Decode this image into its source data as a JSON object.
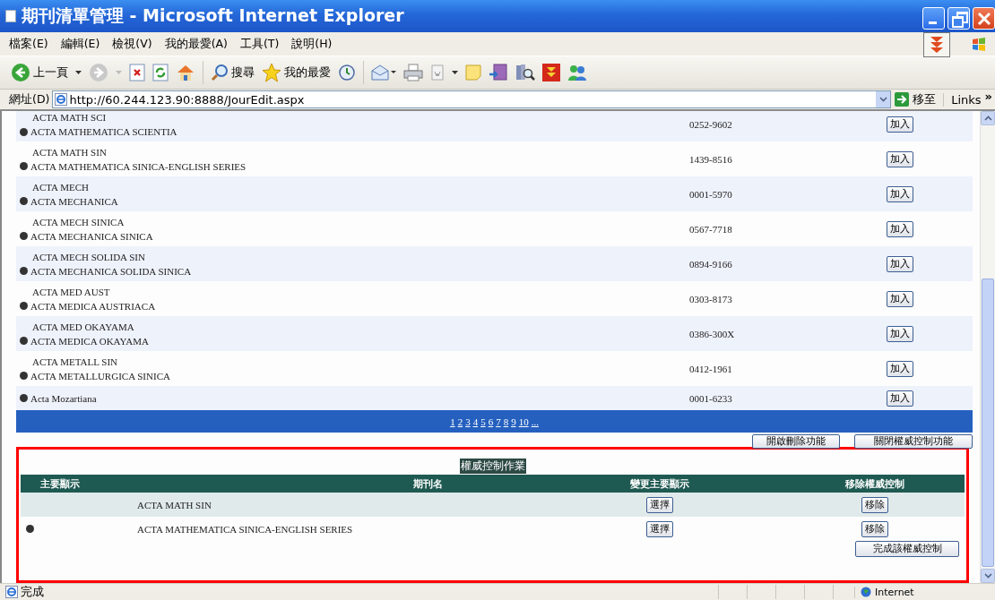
{
  "window": {
    "title": "期刊清單管理 - Microsoft Internet Explorer"
  },
  "menu": [
    "檔案(E)",
    "編輯(E)",
    "檢視(V)",
    "我的最愛(A)",
    "工具(T)",
    "說明(H)"
  ],
  "toolbar": {
    "back": "上一頁",
    "search": "搜尋",
    "favorites": "我的最愛"
  },
  "address": {
    "label": "網址(D)",
    "url": "http://60.244.123.90:8888/JourEdit.aspx",
    "go": "移至",
    "links": "Links",
    "more": "»"
  },
  "journals": [
    {
      "abbrev": "ACTA MATH SCI",
      "title": "ACTA MATHEMATICA SCIENTIA",
      "issn": "0252-9602",
      "action": "加入"
    },
    {
      "abbrev": "ACTA MATH SIN",
      "title": "ACTA MATHEMATICA SINICA-ENGLISH SERIES",
      "issn": "1439-8516",
      "action": "加入"
    },
    {
      "abbrev": "ACTA MECH",
      "title": "ACTA MECHANICA",
      "issn": "0001-5970",
      "action": "加入"
    },
    {
      "abbrev": "ACTA MECH SINICA",
      "title": "ACTA MECHANICA SINICA",
      "issn": "0567-7718",
      "action": "加入"
    },
    {
      "abbrev": "ACTA MECH SOLIDA SIN",
      "title": "ACTA MECHANICA SOLIDA SINICA",
      "issn": "0894-9166",
      "action": "加入"
    },
    {
      "abbrev": "ACTA MED AUST",
      "title": "ACTA MEDICA AUSTRIACA",
      "issn": "0303-8173",
      "action": "加入"
    },
    {
      "abbrev": "ACTA MED OKAYAMA",
      "title": "ACTA MEDICA OKAYAMA",
      "issn": "0386-300X",
      "action": "加入"
    },
    {
      "abbrev": "ACTA METALL SIN",
      "title": "ACTA METALLURGICA SINICA",
      "issn": "0412-1961",
      "action": "加入"
    },
    {
      "title": "Acta Mozartiana",
      "issn": "0001-6233",
      "action": "加入"
    }
  ],
  "pagination": [
    "1",
    "2",
    "3",
    "4",
    "5",
    "6",
    "7",
    "8",
    "9",
    "10",
    "..."
  ],
  "actions": [
    "開啟刪除功能",
    "關閉權威控制功能"
  ],
  "authority": {
    "title": "權威控制作業",
    "columns": [
      "主要顯示",
      "期刊名",
      "變更主要顯示",
      "移除權威控制"
    ],
    "rows": [
      {
        "primary": false,
        "name": "ACTA MATH SIN",
        "select": "選擇",
        "remove": "移除"
      },
      {
        "primary": true,
        "name": "ACTA MATHEMATICA SINICA-ENGLISH SERIES",
        "select": "選擇",
        "remove": "移除"
      }
    ],
    "finish": "完成該權威控制"
  },
  "status_bar": {
    "text": "完成",
    "zone": "Internet"
  }
}
